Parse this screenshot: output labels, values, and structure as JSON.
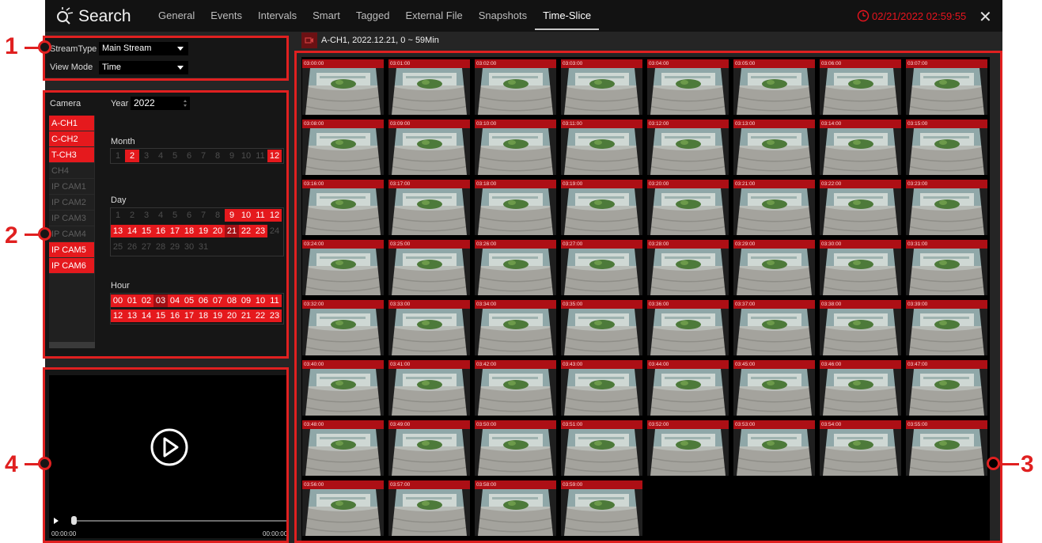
{
  "app": {
    "title": "Search"
  },
  "tabs": [
    "General",
    "Events",
    "Intervals",
    "Smart",
    "Tagged",
    "External File",
    "Snapshots",
    "Time-Slice"
  ],
  "active_tab": "Time-Slice",
  "datetime": "02/21/2022 02:59:55",
  "close_label": "✕",
  "stream": {
    "stream_type_label": "StreamType",
    "stream_type_value": "Main Stream",
    "view_mode_label": "View Mode",
    "view_mode_value": "Time"
  },
  "camera_panel": {
    "camera_label": "Camera",
    "year_label": "Year",
    "year_value": "2022",
    "month_label": "Month",
    "day_label": "Day",
    "hour_label": "Hour",
    "cameras": [
      {
        "name": "A-CH1",
        "on": true
      },
      {
        "name": "C-CH2",
        "on": true
      },
      {
        "name": "T-CH3",
        "on": true
      },
      {
        "name": "CH4",
        "on": false
      },
      {
        "name": "IP CAM1",
        "on": false
      },
      {
        "name": "IP CAM2",
        "on": false
      },
      {
        "name": "IP CAM3",
        "on": false
      },
      {
        "name": "IP CAM4",
        "on": false
      },
      {
        "name": "IP CAM5",
        "on": true
      },
      {
        "name": "IP CAM6",
        "on": true
      }
    ],
    "months": [
      {
        "v": "1",
        "s": 0
      },
      {
        "v": "2",
        "s": 1
      },
      {
        "v": "3",
        "s": 0
      },
      {
        "v": "4",
        "s": 0
      },
      {
        "v": "5",
        "s": 0
      },
      {
        "v": "6",
        "s": 0
      },
      {
        "v": "7",
        "s": 0
      },
      {
        "v": "8",
        "s": 0
      },
      {
        "v": "9",
        "s": 0
      },
      {
        "v": "10",
        "s": 0
      },
      {
        "v": "11",
        "s": 0
      },
      {
        "v": "12",
        "s": 1
      }
    ],
    "days": [
      {
        "v": "1",
        "s": 0
      },
      {
        "v": "2",
        "s": 0
      },
      {
        "v": "3",
        "s": 0
      },
      {
        "v": "4",
        "s": 0
      },
      {
        "v": "5",
        "s": 0
      },
      {
        "v": "6",
        "s": 0
      },
      {
        "v": "7",
        "s": 0
      },
      {
        "v": "8",
        "s": 0
      },
      {
        "v": "9",
        "s": 1
      },
      {
        "v": "10",
        "s": 1
      },
      {
        "v": "11",
        "s": 1
      },
      {
        "v": "12",
        "s": 1
      },
      {
        "v": "13",
        "s": 1
      },
      {
        "v": "14",
        "s": 1
      },
      {
        "v": "15",
        "s": 1
      },
      {
        "v": "16",
        "s": 1
      },
      {
        "v": "17",
        "s": 1
      },
      {
        "v": "18",
        "s": 1
      },
      {
        "v": "19",
        "s": 1
      },
      {
        "v": "20",
        "s": 1
      },
      {
        "v": "21",
        "s": 2
      },
      {
        "v": "22",
        "s": 1
      },
      {
        "v": "23",
        "s": 1
      },
      {
        "v": "24",
        "s": 0
      },
      {
        "v": "25",
        "s": 0
      },
      {
        "v": "26",
        "s": 0
      },
      {
        "v": "27",
        "s": 0
      },
      {
        "v": "28",
        "s": 0
      },
      {
        "v": "29",
        "s": 0
      },
      {
        "v": "30",
        "s": 0
      },
      {
        "v": "31",
        "s": 0
      }
    ],
    "hours": [
      {
        "v": "00",
        "s": 1
      },
      {
        "v": "01",
        "s": 1
      },
      {
        "v": "02",
        "s": 1
      },
      {
        "v": "03",
        "s": 2
      },
      {
        "v": "04",
        "s": 1
      },
      {
        "v": "05",
        "s": 1
      },
      {
        "v": "06",
        "s": 1
      },
      {
        "v": "07",
        "s": 1
      },
      {
        "v": "08",
        "s": 1
      },
      {
        "v": "09",
        "s": 1
      },
      {
        "v": "10",
        "s": 1
      },
      {
        "v": "11",
        "s": 1
      },
      {
        "v": "12",
        "s": 1
      },
      {
        "v": "13",
        "s": 1
      },
      {
        "v": "14",
        "s": 1
      },
      {
        "v": "15",
        "s": 1
      },
      {
        "v": "16",
        "s": 1
      },
      {
        "v": "17",
        "s": 1
      },
      {
        "v": "18",
        "s": 1
      },
      {
        "v": "19",
        "s": 1
      },
      {
        "v": "20",
        "s": 1
      },
      {
        "v": "21",
        "s": 1
      },
      {
        "v": "22",
        "s": 1
      },
      {
        "v": "23",
        "s": 1
      }
    ]
  },
  "player": {
    "time_start": "00:00:00",
    "time_end": "00:00:00",
    "progress": 0
  },
  "info_bar": {
    "text": "A-CH1,   2022.12.21,   0 ~ 59Min"
  },
  "thumbnails": [
    "03:00:00",
    "03:01:00",
    "03:02:00",
    "03:03:00",
    "03:04:00",
    "03:05:00",
    "03:06:00",
    "03:07:00",
    "03:08:00",
    "03:09:00",
    "03:10:00",
    "03:11:00",
    "03:12:00",
    "03:13:00",
    "03:14:00",
    "03:15:00",
    "03:16:00",
    "03:17:00",
    "03:18:00",
    "03:19:00",
    "03:20:00",
    "03:21:00",
    "03:22:00",
    "03:23:00",
    "03:24:00",
    "03:25:00",
    "03:26:00",
    "03:27:00",
    "03:28:00",
    "03:29:00",
    "03:30:00",
    "03:31:00",
    "03:32:00",
    "03:33:00",
    "03:34:00",
    "03:35:00",
    "03:36:00",
    "03:37:00",
    "03:38:00",
    "03:39:00",
    "03:40:00",
    "03:41:00",
    "03:42:00",
    "03:43:00",
    "03:44:00",
    "03:45:00",
    "03:46:00",
    "03:47:00",
    "03:48:00",
    "03:49:00",
    "03:50:00",
    "03:51:00",
    "03:52:00",
    "03:53:00",
    "03:54:00",
    "03:55:00",
    "03:56:00",
    "03:57:00",
    "03:58:00",
    "03:59:00"
  ],
  "callouts": [
    "1",
    "2",
    "3",
    "4"
  ],
  "colors": {
    "accent": "#e5191d",
    "callout": "#e02020",
    "background": "#252525",
    "date_text": "#e8141e"
  }
}
